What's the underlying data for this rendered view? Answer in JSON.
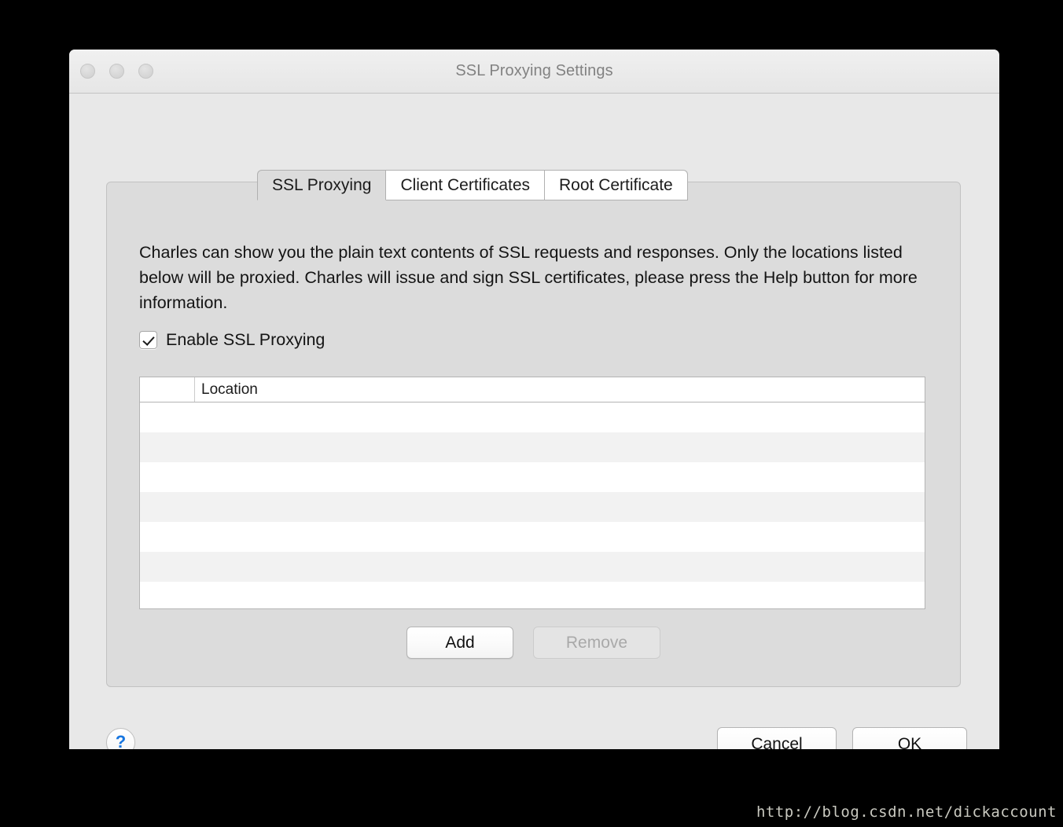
{
  "window": {
    "title": "SSL Proxying Settings",
    "traffic_lights": [
      "close-button",
      "minimize-button",
      "zoom-button"
    ]
  },
  "tabs": [
    {
      "label": "SSL Proxying",
      "selected": true
    },
    {
      "label": "Client Certificates",
      "selected": false
    },
    {
      "label": "Root Certificate",
      "selected": false
    }
  ],
  "panel": {
    "description": "Charles can show you the plain text contents of SSL requests and responses. Only the locations listed below will be proxied. Charles will issue and sign SSL certificates, please press the Help button for more information.",
    "enable_checkbox": {
      "label": "Enable SSL Proxying",
      "checked": true
    },
    "table": {
      "columns": [
        "",
        "Location"
      ],
      "rows": [],
      "empty_row_count": 7
    },
    "list_buttons": {
      "add_label": "Add",
      "remove_label": "Remove",
      "remove_disabled": true
    }
  },
  "footer": {
    "help_label": "?",
    "cancel_label": "Cancel",
    "ok_label": "OK"
  },
  "watermark": {
    "text": "http://blog.csdn.net/dickaccount"
  },
  "colors": {
    "window_bg": "#e8e8e8",
    "panel_bg": "#dcdcdc",
    "titlebar_text": "#828282",
    "accent_blue": "#1675e0",
    "row_alt": "#f2f2f2",
    "desktop": "#000000"
  }
}
